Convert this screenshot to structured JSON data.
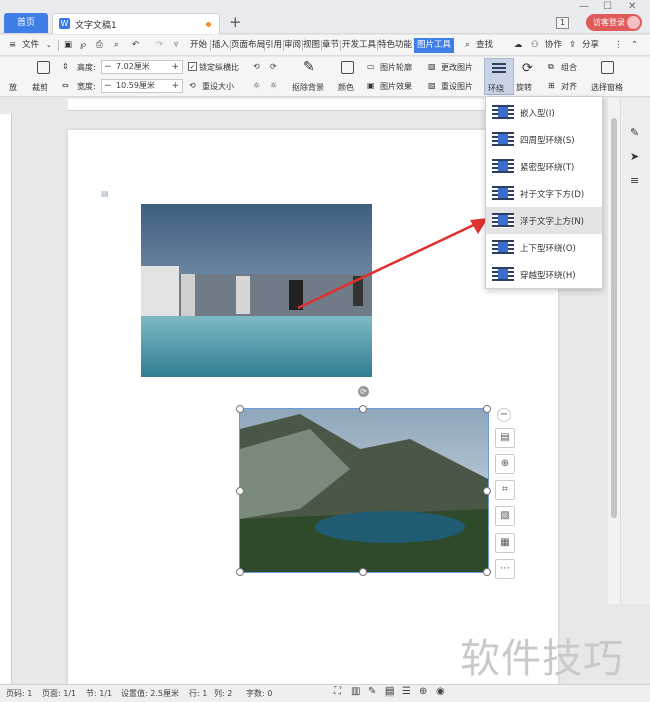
{
  "tabs": {
    "home": "首页",
    "doc": "文字文稿1",
    "new_tab": "+"
  },
  "window": {
    "minimize": "—",
    "maximize": "☐",
    "close": "✕",
    "badge": "1",
    "login": "访客登录"
  },
  "menu": {
    "file": "文件",
    "items": [
      "开始",
      "插入",
      "页面布局",
      "引用",
      "审阅",
      "视图",
      "章节",
      "开发工具",
      "特色功能"
    ],
    "active": "图片工具",
    "search": "查找",
    "collab": "协作",
    "share": "分享"
  },
  "ribbon": {
    "cut": "放",
    "crop": "裁剪",
    "height_label": "高度:",
    "height_value": "7.02厘米",
    "width_label": "宽度:",
    "width_value": "10.59厘米",
    "lock_ratio": "锁定纵横比",
    "reset_size": "重设大小",
    "remove_bg": "抠除背景",
    "color": "颜色",
    "outline": "图片轮廓",
    "effect": "图片效果",
    "change_pic": "更改图片",
    "reset_pic": "重设图片",
    "wrap": "环绕",
    "rotate": "旋转",
    "group": "组合",
    "align": "对齐",
    "select_pane": "选择窗格"
  },
  "wrap_menu": [
    "嵌入型(I)",
    "四周型环绕(S)",
    "紧密型环绕(T)",
    "衬于文字下方(D)",
    "浮于文字上方(N)",
    "上下型环绕(O)",
    "穿越型环绕(H)"
  ],
  "wrap_menu_selected": "浮于文字上方(N)",
  "status": {
    "page_code": "页码: 1",
    "pages": "页面: 1/1",
    "section": "节: 1/1",
    "setting": "设置值: 2.5厘米",
    "row": "行: 1",
    "col": "列: 2",
    "words": "字数: 0"
  },
  "watermark": "软件技巧",
  "colors": {
    "accent": "#3e7ee6",
    "login": "#e05a5a",
    "arrow": "#e03030"
  }
}
